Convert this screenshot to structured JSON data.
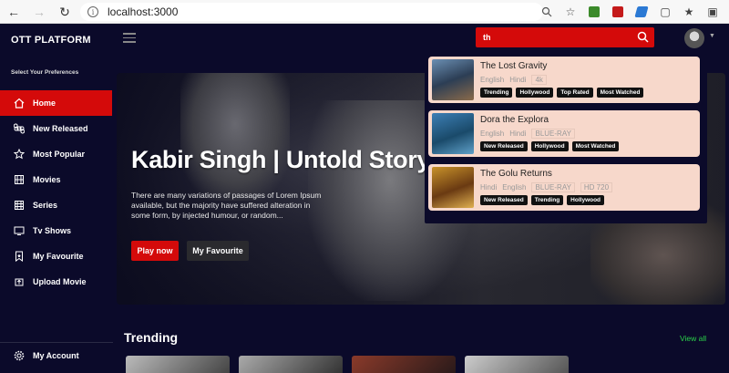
{
  "browser": {
    "url": "localhost:3000"
  },
  "app": {
    "brand": "OTT PLATFORM",
    "preferences_label": "Select Your Preferences",
    "menu": [
      {
        "label": "Home",
        "icon": "home-icon",
        "active": true
      },
      {
        "label": "New Released",
        "icon": "command-icon"
      },
      {
        "label": "Most Popular",
        "icon": "star-icon"
      },
      {
        "label": "Movies",
        "icon": "film-icon"
      },
      {
        "label": "Series",
        "icon": "film-icon"
      },
      {
        "label": "Tv Shows",
        "icon": "tv-icon"
      },
      {
        "label": "My Favourite",
        "icon": "bookmark-icon"
      },
      {
        "label": "Upload Movie",
        "icon": "upload-icon"
      }
    ],
    "account": {
      "label": "My Account",
      "icon": "gear-icon"
    },
    "search": {
      "value": "th"
    },
    "accent": "#d40a0a"
  },
  "hero": {
    "title": "Kabir Singh | Untold Story",
    "description": "There are many variations of passages of Lorem Ipsum available, but the majority have suffered alteration in some form, by injected humour, or random...",
    "play_label": "Play now",
    "favourite_label": "My Favourite"
  },
  "trending": {
    "title": "Trending",
    "view_all": "View all"
  },
  "results": [
    {
      "title": "The Lost Gravity",
      "langs": [
        "English",
        "Hindi"
      ],
      "qualities": [
        "4k"
      ],
      "tags": [
        "Trending",
        "Hollywood",
        "Top Rated",
        "Most Watched"
      ]
    },
    {
      "title": "Dora the Explora",
      "langs": [
        "English",
        "Hindi"
      ],
      "qualities": [
        "BLUE-RAY"
      ],
      "tags": [
        "New Released",
        "Hollywood",
        "Most Watched"
      ]
    },
    {
      "title": "The Golu Returns",
      "langs": [
        "Hindi",
        "English"
      ],
      "qualities": [
        "BLUE-RAY",
        "HD 720"
      ],
      "tags": [
        "New Released",
        "Trending",
        "Hollywood"
      ]
    }
  ]
}
